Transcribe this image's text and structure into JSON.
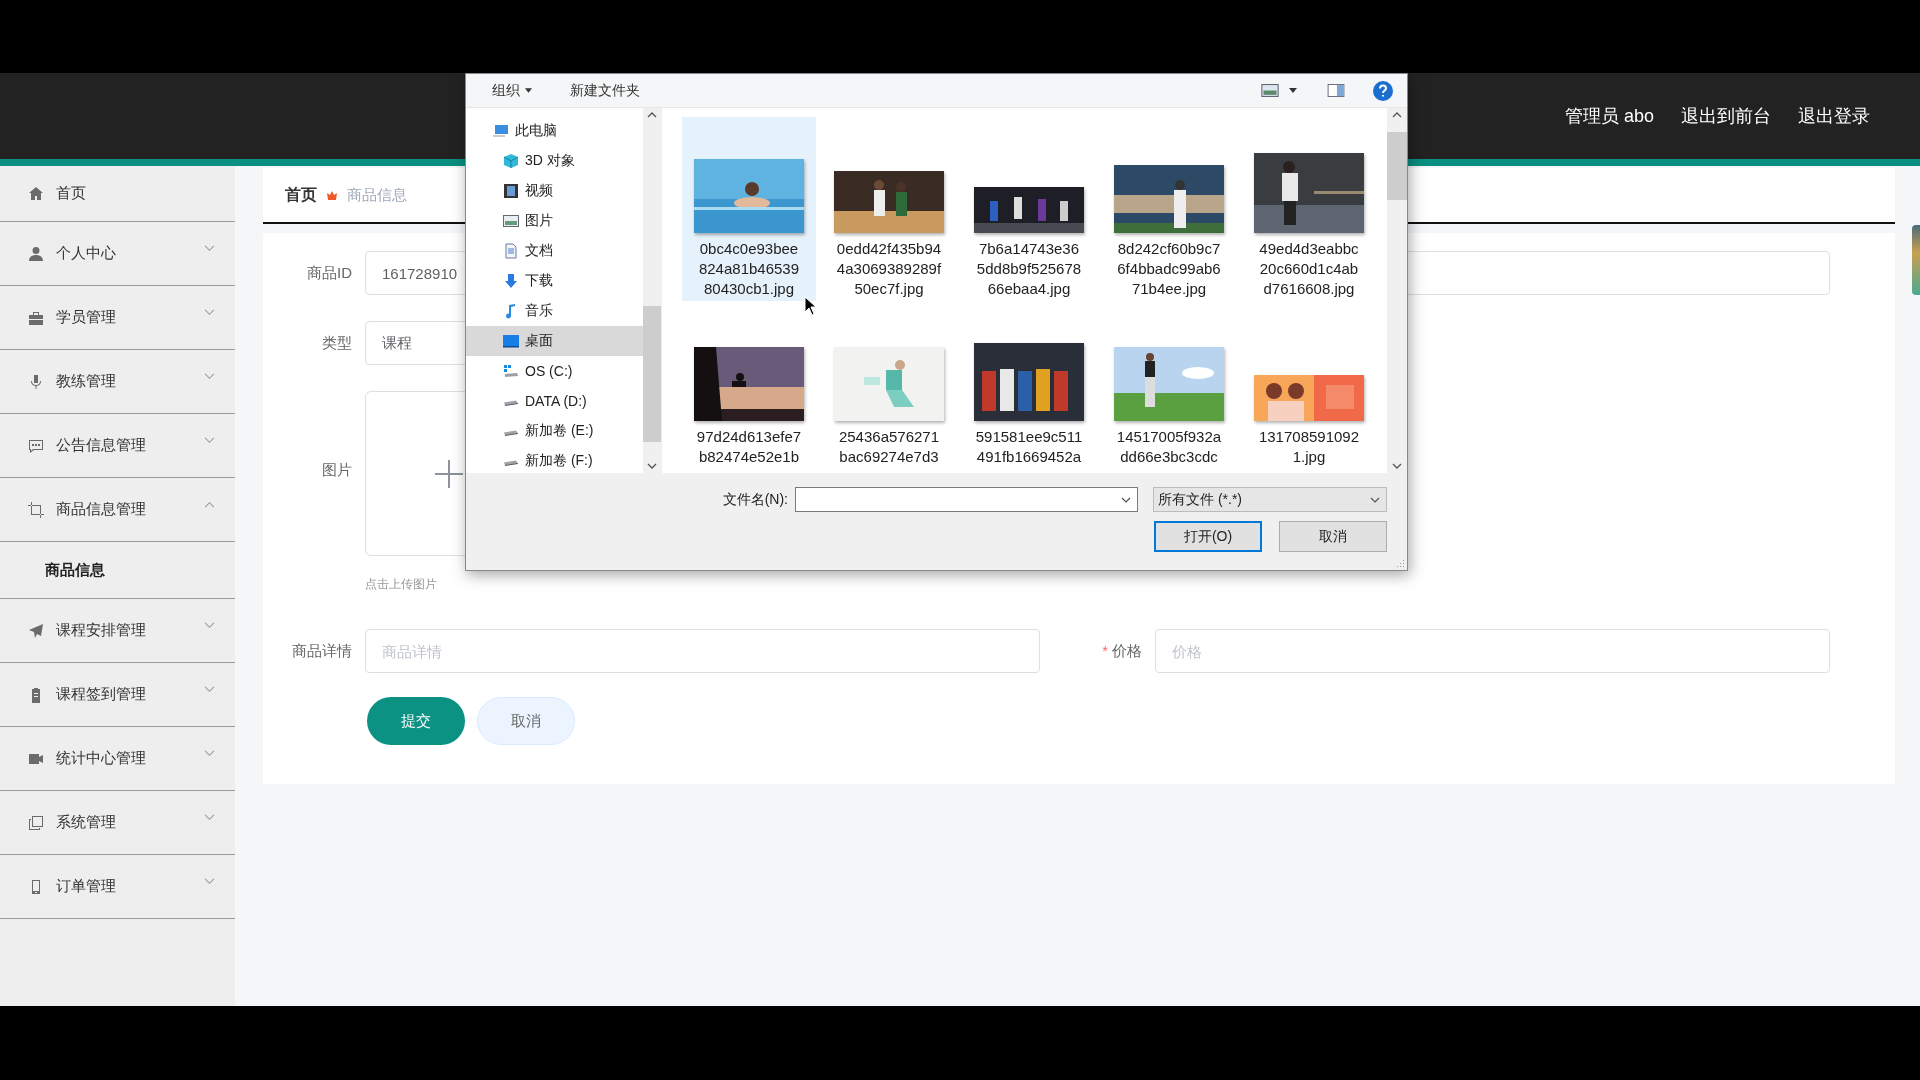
{
  "header": {
    "user": "管理员 abo",
    "links": [
      "退出到前台",
      "退出登录"
    ]
  },
  "sidebar": {
    "items": [
      {
        "label": "首页",
        "kind": "link"
      },
      {
        "label": "个人中心",
        "kind": "menu",
        "expanded": false
      },
      {
        "label": "学员管理",
        "kind": "menu",
        "expanded": false
      },
      {
        "label": "教练管理",
        "kind": "menu",
        "expanded": false
      },
      {
        "label": "公告信息管理",
        "kind": "menu",
        "expanded": false
      },
      {
        "label": "商品信息管理",
        "kind": "menu",
        "expanded": true,
        "children": [
          {
            "label": "商品信息",
            "selected": true
          }
        ]
      },
      {
        "label": "课程安排管理",
        "kind": "menu",
        "expanded": false
      },
      {
        "label": "课程签到管理",
        "kind": "menu",
        "expanded": false
      },
      {
        "label": "统计中心管理",
        "kind": "menu",
        "expanded": false
      },
      {
        "label": "系统管理",
        "kind": "menu",
        "expanded": false
      },
      {
        "label": "订单管理",
        "kind": "menu",
        "expanded": false
      }
    ]
  },
  "breadcrumb": [
    "首页",
    "商品信息"
  ],
  "form": {
    "id": {
      "label": "商品ID",
      "value": "161728910"
    },
    "type": {
      "label": "类型",
      "value": "课程"
    },
    "image": {
      "label": "图片",
      "hint": "点击上传图片"
    },
    "details": {
      "label": "商品详情",
      "placeholder": "商品详情"
    },
    "price": {
      "mark": "*",
      "label": "价格",
      "placeholder": "价格"
    },
    "buttons": [
      "提交",
      "取消"
    ]
  },
  "dialog": {
    "toolbar": {
      "organize": "组织",
      "new_folder": "新建文件夹"
    },
    "nav": [
      {
        "label": "此电脑",
        "selected": false,
        "children": [
          {
            "label": "3D 对象",
            "selected": false
          },
          {
            "label": "视频",
            "selected": false
          },
          {
            "label": "图片",
            "selected": false
          },
          {
            "label": "文档",
            "selected": false
          },
          {
            "label": "下载",
            "selected": false
          },
          {
            "label": "音乐",
            "selected": false
          },
          {
            "label": "桌面",
            "selected": true
          },
          {
            "label": "OS (C:)",
            "selected": false
          },
          {
            "label": "DATA (D:)",
            "selected": false
          },
          {
            "label": "新加卷 (E:)",
            "selected": false
          },
          {
            "label": "新加卷 (F:)",
            "selected": false
          }
        ]
      }
    ],
    "files": [
      {
        "lines": [
          "0bc4c0e93bee",
          "824a81b46539",
          "80430cb1.jpg"
        ],
        "selected": true
      },
      {
        "lines": [
          "0edd42f435b94",
          "4a3069389289f",
          "50ec7f.jpg"
        ],
        "selected": false
      },
      {
        "lines": [
          "7b6a14743e36",
          "5dd8b9f525678",
          "66ebaa4.jpg"
        ],
        "selected": false
      },
      {
        "lines": [
          "8d242cf60b9c7",
          "6f4bbadc99ab6",
          "71b4ee.jpg"
        ],
        "selected": false
      },
      {
        "lines": [
          "49ed4d3eabbc",
          "20c660d1c4ab",
          "d7616608.jpg"
        ],
        "selected": false
      },
      {
        "lines": [
          "97d24d613efe7",
          "b82474e52e1b"
        ],
        "selected": false
      },
      {
        "lines": [
          "25436a576271",
          "bac69274e7d3"
        ],
        "selected": false
      },
      {
        "lines": [
          "591581ee9c511",
          "491fb1669452a"
        ],
        "selected": false
      },
      {
        "lines": [
          "14517005f932a",
          "dd66e3bc3cdc"
        ],
        "selected": false
      },
      {
        "lines": [
          "131708591092",
          "1.jpg"
        ],
        "selected": false
      }
    ],
    "filename": {
      "label": "文件名(N):"
    },
    "filter": "所有文件 (*.*)",
    "buttons": [
      {
        "label": "打开(O)",
        "default": true
      },
      {
        "label": "取消",
        "default": false
      }
    ]
  }
}
